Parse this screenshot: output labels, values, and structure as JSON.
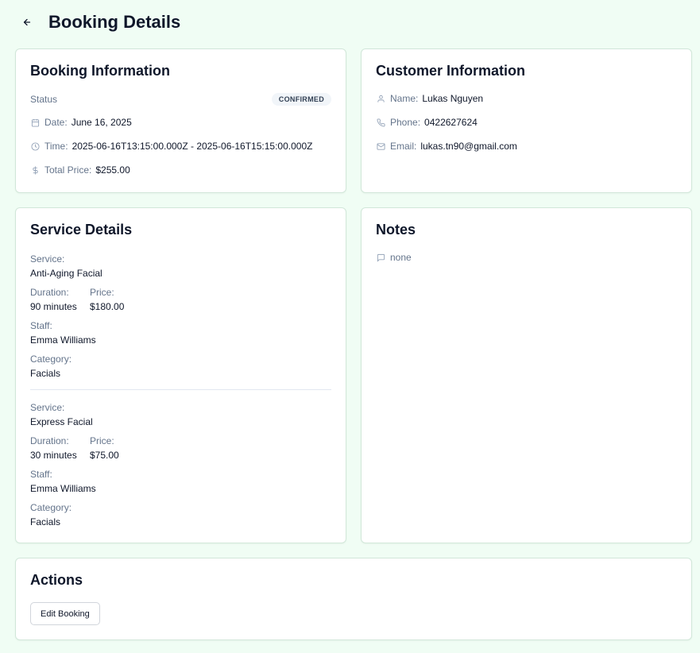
{
  "page": {
    "title": "Booking Details"
  },
  "booking": {
    "title": "Booking Information",
    "status_label": "Status",
    "status": "CONFIRMED",
    "date_label": "Date:",
    "date": "June 16, 2025",
    "time_label": "Time:",
    "time": "2025-06-16T13:15:00.000Z - 2025-06-16T15:15:00.000Z",
    "total_label": "Total Price:",
    "total": "$255.00"
  },
  "customer": {
    "title": "Customer Information",
    "name_label": "Name:",
    "name": "Lukas Nguyen",
    "phone_label": "Phone:",
    "phone": "0422627624",
    "email_label": "Email:",
    "email": "lukas.tn90@gmail.com"
  },
  "services": {
    "title": "Service Details",
    "service_label": "Service:",
    "duration_label": "Duration:",
    "price_label": "Price:",
    "staff_label": "Staff:",
    "category_label": "Category:",
    "items": [
      {
        "service": "Anti-Aging Facial",
        "duration": "90 minutes",
        "price": "$180.00",
        "staff": "Emma Williams",
        "category": "Facials"
      },
      {
        "service": "Express Facial",
        "duration": "30 minutes",
        "price": "$75.00",
        "staff": "Emma Williams",
        "category": "Facials"
      }
    ]
  },
  "notes": {
    "title": "Notes",
    "text": "none"
  },
  "actions": {
    "title": "Actions",
    "edit_label": "Edit Booking"
  },
  "icons": {
    "back": "arrow-left-icon",
    "date": "calendar-icon",
    "time": "clock-icon",
    "price": "dollar-icon",
    "name": "user-icon",
    "phone": "phone-icon",
    "email": "mail-icon",
    "notes": "message-square-icon"
  },
  "colors": {
    "background": "#f0fdf4",
    "card": "#ffffff",
    "text": "#0f172a",
    "muted": "#64748b",
    "badge_bg": "#f1f5f9"
  }
}
